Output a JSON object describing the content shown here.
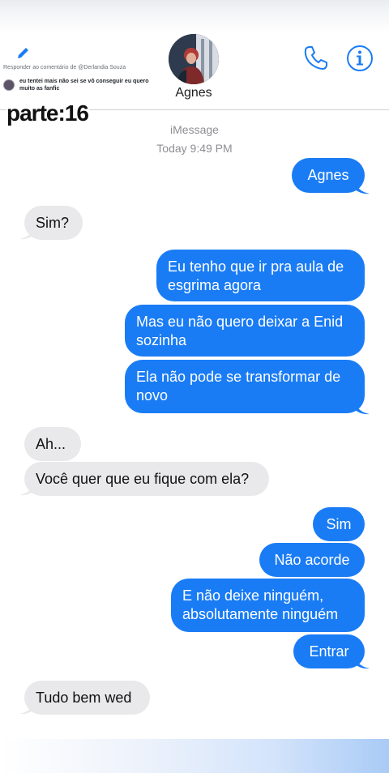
{
  "contact": {
    "name": "Agnes"
  },
  "reply_overlay": {
    "title": "Responder ao comentário de @Derlandia Souza",
    "comment": "eu tentei mais não sei se vô conseguir eu quero muito as fanfic"
  },
  "part_label": "parte:16",
  "conversation": {
    "service": "iMessage",
    "timestamp": "Today 9:49 PM",
    "messages": [
      {
        "side": "sent",
        "text": "Agnes"
      },
      {
        "side": "received",
        "text": "Sim?"
      },
      {
        "side": "sent",
        "text": "Eu tenho que ir pra aula de esgrima agora"
      },
      {
        "side": "sent",
        "text": "Mas eu não quero deixar a Enid sozinha"
      },
      {
        "side": "sent",
        "text": "Ela não pode se transformar de novo"
      },
      {
        "side": "received",
        "text": "Ah..."
      },
      {
        "side": "received",
        "text": "Você quer que eu fique com ela?"
      },
      {
        "side": "sent",
        "text": "Sim"
      },
      {
        "side": "sent",
        "text": "Não acorde"
      },
      {
        "side": "sent",
        "text": "E não deixe ninguém, absolutamente ninguém"
      },
      {
        "side": "sent",
        "text": "Entrar"
      },
      {
        "side": "received",
        "text": "Tudo bem wed"
      }
    ]
  },
  "icons": {
    "phone": "phone-icon",
    "info": "info-icon",
    "edit": "pencil-icon"
  },
  "colors": {
    "sent_bubble": "#1a7cf5",
    "received_bubble": "#e9e9eb",
    "accent": "#1a7cf5"
  }
}
